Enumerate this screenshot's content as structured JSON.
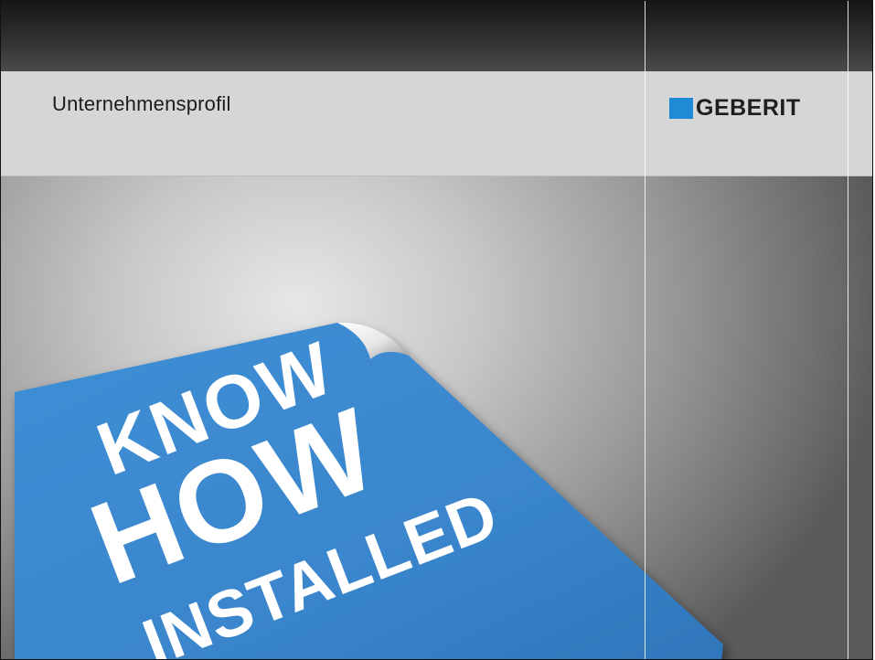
{
  "header": {
    "title": "Unternehmensprofil"
  },
  "logo": {
    "text": "GEBERIT",
    "square_color": "#1f8ad6"
  },
  "poster": {
    "line1": "KNOW",
    "line2": "HOW",
    "line3": "INSTALLED",
    "sticker_color": "#3a86cc",
    "text_color": "#ffffff"
  }
}
